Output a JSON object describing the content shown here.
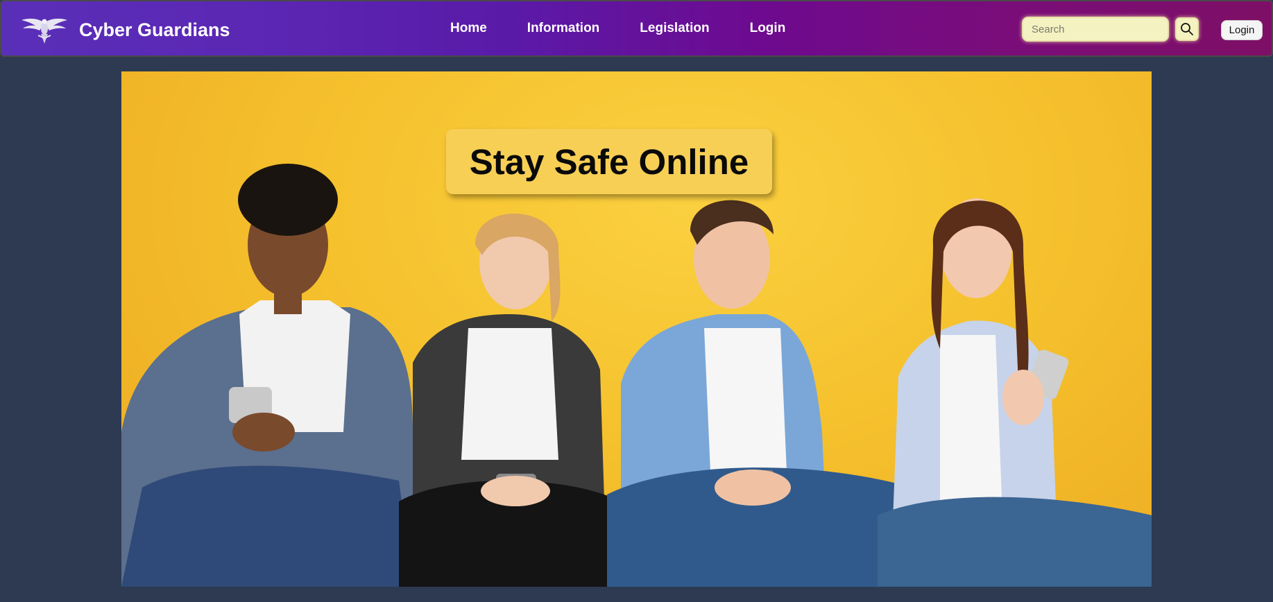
{
  "header": {
    "brand_title": "Cyber Guardians",
    "logo_icon": "eagle-logo-icon",
    "nav": [
      {
        "label": "Home"
      },
      {
        "label": "Information"
      },
      {
        "label": "Legislation"
      },
      {
        "label": "Login"
      }
    ],
    "search": {
      "placeholder": "Search",
      "value": "",
      "button_icon": "search-icon"
    },
    "login_button": "Login"
  },
  "hero": {
    "heading": "Stay Safe Online",
    "image": "four-teens-with-smartphones-photo"
  },
  "colors": {
    "page_background": "#2d3a52",
    "nav_gradient_start": "#5a2fb8",
    "nav_gradient_end": "#7e0f66",
    "hero_background": "#f5c12d",
    "search_background": "#f5f2c2"
  }
}
